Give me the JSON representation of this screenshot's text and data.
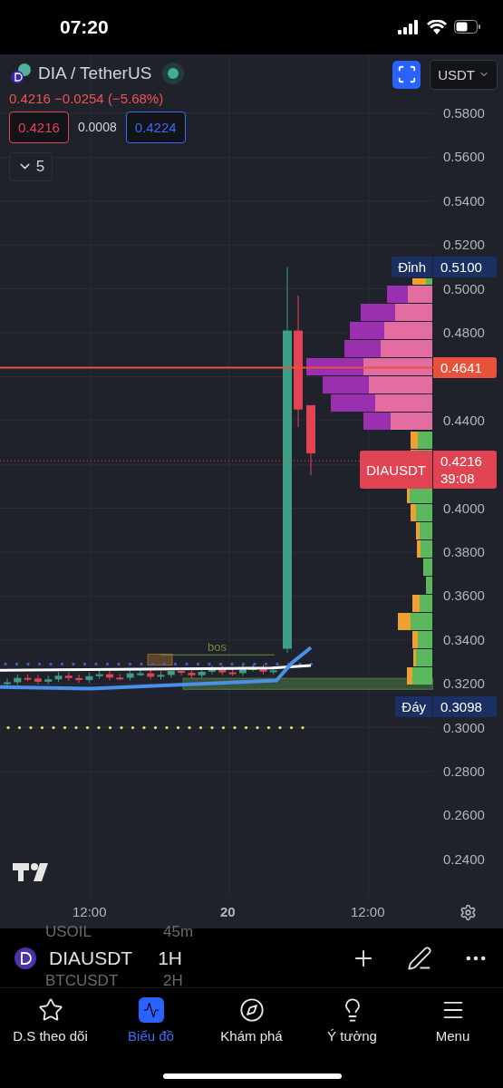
{
  "status_bar": {
    "time": "07:20"
  },
  "header": {
    "symbol": "DIA / TetherUS",
    "market_open": true,
    "quote": {
      "price": "0.4216",
      "change": "−0.0254",
      "percent": "(−5.68%)"
    },
    "bid": "0.4216",
    "spread": "0.0008",
    "ask": "0.4224",
    "indicators_toggle": {
      "count": "5",
      "expanded": false
    }
  },
  "currency_button": "USDT",
  "price_axis": {
    "ticks": [
      "0.5800",
      "0.5600",
      "0.5400",
      "0.5200",
      "0.5000",
      "0.4800",
      "0.4400",
      "0.4000",
      "0.3800",
      "0.3600",
      "0.3400",
      "0.3200",
      "0.3000",
      "0.2800",
      "0.2600",
      "0.2400"
    ],
    "markers": [
      {
        "kind": "high",
        "label": "Đỉnh",
        "value": "0.5100"
      },
      {
        "kind": "last",
        "value": "0.4641"
      },
      {
        "kind": "current",
        "label": "DIAUSDT",
        "value": "0.4216",
        "countdown": "39:08"
      },
      {
        "kind": "low",
        "label": "Đáy",
        "value": "0.3098"
      }
    ]
  },
  "chart": {
    "annotation": "bos"
  },
  "time_axis": [
    {
      "label": "12:00",
      "major": false
    },
    {
      "label": "20",
      "major": true
    },
    {
      "label": "12:00",
      "major": false
    }
  ],
  "symbol_bar": {
    "symbol": "DIAUSDT",
    "interval": "1H",
    "background_rows": [
      {
        "symbol": "USOIL",
        "interval": "45m"
      },
      {
        "symbol": "BTCUSDT",
        "interval": "2H"
      }
    ]
  },
  "tab_bar": [
    {
      "label": "D.S theo dõi",
      "selected": false
    },
    {
      "label": "Biểu đồ",
      "selected": true
    },
    {
      "label": "Khám phá",
      "selected": false
    },
    {
      "label": "Ý tưởng",
      "selected": false
    },
    {
      "label": "Menu",
      "selected": false
    }
  ]
}
